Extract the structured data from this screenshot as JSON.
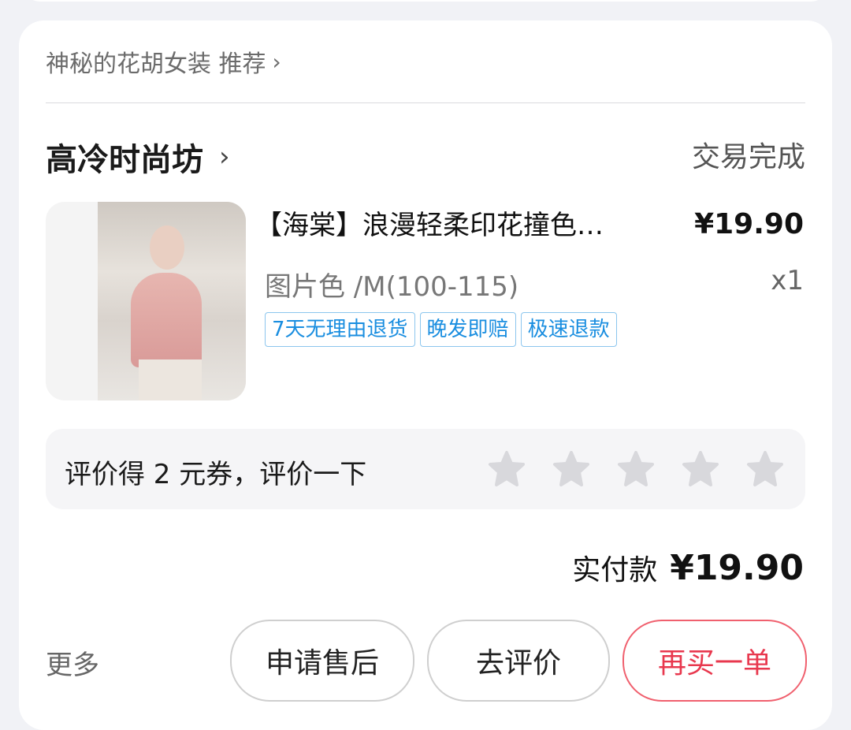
{
  "recommendation": {
    "text": "神秘的花胡女装 推荐"
  },
  "shop": {
    "name": "高冷时尚坊",
    "status": "交易完成"
  },
  "product": {
    "title": "【海棠】浪漫轻柔印花撞色…",
    "price": "¥19.90",
    "spec": "图片色 /M(100-115)",
    "quantity": "x1",
    "tags": [
      "7天无理由退货",
      "晚发即赔",
      "极速退款"
    ]
  },
  "review": {
    "prompt": "评价得 2 元券，评价一下",
    "stars": 5
  },
  "payment": {
    "label": "实付款",
    "amount": "¥19.90"
  },
  "actions": {
    "more": "更多",
    "after_sales": "申请售后",
    "review": "去评价",
    "rebuy": "再买一单"
  },
  "colors": {
    "accent": "#e8384e",
    "tag": "#1a8ee0",
    "star": "#d8d8dc"
  }
}
